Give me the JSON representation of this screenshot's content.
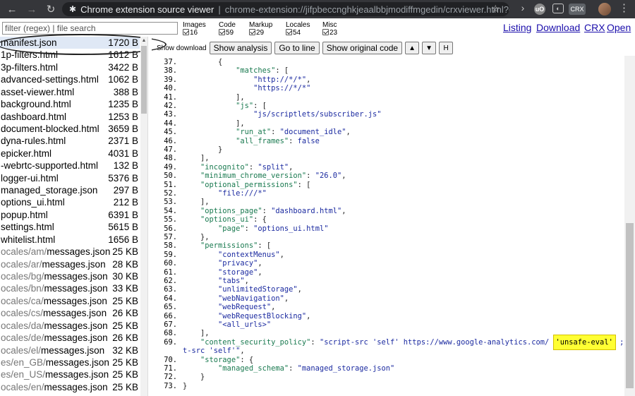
{
  "browser": {
    "tab_title": "Chrome extension source viewer",
    "url": "chrome-extension://jifpbeccnghkjeaalbbjmodiffmgedin/crxviewer.html?cr...",
    "ext_ublock": "uO",
    "ext_crx": "CRX"
  },
  "toolbar": {
    "filter_placeholder": "filter (regex) | file search",
    "categories": [
      {
        "label": "Images",
        "count": "16"
      },
      {
        "label": "Code",
        "count": "59"
      },
      {
        "label": "Markup",
        "count": "29"
      },
      {
        "label": "Locales",
        "count": "54"
      },
      {
        "label": "Misc",
        "count": "23"
      }
    ],
    "links": [
      "Listing",
      "Download",
      "CRX",
      "Open"
    ]
  },
  "code_toolbar": {
    "toggle_text": "Show download",
    "buttons": [
      "Show analysis",
      "Go to line",
      "Show original code",
      "▲",
      "▼",
      "H"
    ]
  },
  "files": [
    {
      "dir": "",
      "name": "manifest.json",
      "size": "1720 B",
      "selected": true
    },
    {
      "dir": "",
      "name": "1p-filters.html",
      "size": "1612 B"
    },
    {
      "dir": "",
      "name": "3p-filters.html",
      "size": "3422 B"
    },
    {
      "dir": "",
      "name": "advanced-settings.html",
      "size": "1062 B"
    },
    {
      "dir": "",
      "name": "asset-viewer.html",
      "size": "388 B"
    },
    {
      "dir": "",
      "name": "background.html",
      "size": "1235 B"
    },
    {
      "dir": "",
      "name": "dashboard.html",
      "size": "1253 B"
    },
    {
      "dir": "",
      "name": "document-blocked.html",
      "size": "3659 B"
    },
    {
      "dir": "",
      "name": "dyna-rules.html",
      "size": "2371 B"
    },
    {
      "dir": "",
      "name": "epicker.html",
      "size": "4031 B"
    },
    {
      "dir": "",
      "name": "-webrtc-supported.html",
      "size": "132 B"
    },
    {
      "dir": "",
      "name": "logger-ui.html",
      "size": "5376 B"
    },
    {
      "dir": "",
      "name": "managed_storage.json",
      "size": "297 B"
    },
    {
      "dir": "",
      "name": "options_ui.html",
      "size": "212 B"
    },
    {
      "dir": "",
      "name": "popup.html",
      "size": "6391 B"
    },
    {
      "dir": "",
      "name": "settings.html",
      "size": "5615 B"
    },
    {
      "dir": "",
      "name": "whitelist.html",
      "size": "1656 B"
    },
    {
      "dir": "ocales/am/",
      "name": "messages.json",
      "size": "25 KB"
    },
    {
      "dir": "ocales/ar/",
      "name": "messages.json",
      "size": "28 KB"
    },
    {
      "dir": "ocales/bg/",
      "name": "messages.json",
      "size": "30 KB"
    },
    {
      "dir": "ocales/bn/",
      "name": "messages.json",
      "size": "33 KB"
    },
    {
      "dir": "ocales/ca/",
      "name": "messages.json",
      "size": "25 KB"
    },
    {
      "dir": "ocales/cs/",
      "name": "messages.json",
      "size": "26 KB"
    },
    {
      "dir": "ocales/da/",
      "name": "messages.json",
      "size": "25 KB"
    },
    {
      "dir": "ocales/de/",
      "name": "messages.json",
      "size": "26 KB"
    },
    {
      "dir": "ocales/el/",
      "name": "messages.json",
      "size": "32 KB"
    },
    {
      "dir": "es/en_GB/",
      "name": "messages.json",
      "size": "25 KB"
    },
    {
      "dir": "es/en_US/",
      "name": "messages.json",
      "size": "25 KB"
    },
    {
      "dir": "ocales/en/",
      "name": "messages.json",
      "size": "25 KB"
    }
  ],
  "code_lines": [
    {
      "n": "37.",
      "parts": [
        [
          "p",
          "        {"
        ]
      ]
    },
    {
      "n": "38.",
      "parts": [
        [
          "k",
          "            \"matches\""
        ],
        [
          "p",
          ": ["
        ]
      ]
    },
    {
      "n": "39.",
      "parts": [
        [
          "s",
          "                \"http://*/*\""
        ],
        [
          "p",
          ","
        ]
      ]
    },
    {
      "n": "40.",
      "parts": [
        [
          "s",
          "                \"https://*/*\""
        ]
      ]
    },
    {
      "n": "41.",
      "parts": [
        [
          "p",
          "            ],"
        ]
      ]
    },
    {
      "n": "42.",
      "parts": [
        [
          "k",
          "            \"js\""
        ],
        [
          "p",
          ": ["
        ]
      ]
    },
    {
      "n": "43.",
      "parts": [
        [
          "s",
          "                \"js/scriptlets/subscriber.js\""
        ]
      ]
    },
    {
      "n": "44.",
      "parts": [
        [
          "p",
          "            ],"
        ]
      ]
    },
    {
      "n": "45.",
      "parts": [
        [
          "k",
          "            \"run_at\""
        ],
        [
          "p",
          ": "
        ],
        [
          "s",
          "\"document_idle\""
        ],
        [
          "p",
          ","
        ]
      ]
    },
    {
      "n": "46.",
      "parts": [
        [
          "k",
          "            \"all_frames\""
        ],
        [
          "p",
          ": "
        ],
        [
          "s",
          "false"
        ]
      ]
    },
    {
      "n": "47.",
      "parts": [
        [
          "p",
          "        }"
        ]
      ]
    },
    {
      "n": "48.",
      "parts": [
        [
          "p",
          "    ],"
        ]
      ]
    },
    {
      "n": "49.",
      "parts": [
        [
          "k",
          "    \"incognito\""
        ],
        [
          "p",
          ": "
        ],
        [
          "s",
          "\"split\""
        ],
        [
          "p",
          ","
        ]
      ]
    },
    {
      "n": "50.",
      "parts": [
        [
          "k",
          "    \"minimum_chrome_version\""
        ],
        [
          "p",
          ": "
        ],
        [
          "s",
          "\"26.0\""
        ],
        [
          "p",
          ","
        ]
      ]
    },
    {
      "n": "51.",
      "parts": [
        [
          "k",
          "    \"optional_permissions\""
        ],
        [
          "p",
          ": ["
        ]
      ]
    },
    {
      "n": "52.",
      "parts": [
        [
          "s",
          "        \"file:///*\""
        ]
      ]
    },
    {
      "n": "53.",
      "parts": [
        [
          "p",
          "    ],"
        ]
      ]
    },
    {
      "n": "54.",
      "parts": [
        [
          "k",
          "    \"options_page\""
        ],
        [
          "p",
          ": "
        ],
        [
          "s",
          "\"dashboard.html\""
        ],
        [
          "p",
          ","
        ]
      ]
    },
    {
      "n": "55.",
      "parts": [
        [
          "k",
          "    \"options_ui\""
        ],
        [
          "p",
          ": {"
        ]
      ]
    },
    {
      "n": "56.",
      "parts": [
        [
          "k",
          "        \"page\""
        ],
        [
          "p",
          ": "
        ],
        [
          "s",
          "\"options_ui.html\""
        ]
      ]
    },
    {
      "n": "57.",
      "parts": [
        [
          "p",
          "    },"
        ]
      ]
    },
    {
      "n": "58.",
      "parts": [
        [
          "k",
          "    \"permissions\""
        ],
        [
          "p",
          ": ["
        ]
      ]
    },
    {
      "n": "59.",
      "parts": [
        [
          "s",
          "        \"contextMenus\""
        ],
        [
          "p",
          ","
        ]
      ]
    },
    {
      "n": "60.",
      "parts": [
        [
          "s",
          "        \"privacy\""
        ],
        [
          "p",
          ","
        ]
      ]
    },
    {
      "n": "61.",
      "parts": [
        [
          "s",
          "        \"storage\""
        ],
        [
          "p",
          ","
        ]
      ]
    },
    {
      "n": "62.",
      "parts": [
        [
          "s",
          "        \"tabs\""
        ],
        [
          "p",
          ","
        ]
      ]
    },
    {
      "n": "63.",
      "parts": [
        [
          "s",
          "        \"unlimitedStorage\""
        ],
        [
          "p",
          ","
        ]
      ]
    },
    {
      "n": "64.",
      "parts": [
        [
          "s",
          "        \"webNavigation\""
        ],
        [
          "p",
          ","
        ]
      ]
    },
    {
      "n": "65.",
      "parts": [
        [
          "s",
          "        \"webRequest\""
        ],
        [
          "p",
          ","
        ]
      ]
    },
    {
      "n": "66.",
      "parts": [
        [
          "s",
          "        \"webRequestBlocking\""
        ],
        [
          "p",
          ","
        ]
      ]
    },
    {
      "n": "67.",
      "parts": [
        [
          "s",
          "        \"<all_urls>\""
        ]
      ]
    },
    {
      "n": "68.",
      "parts": [
        [
          "p",
          "    ],"
        ]
      ]
    },
    {
      "n": "69.",
      "parts": [
        [
          "k",
          "    \"content_security_policy\""
        ],
        [
          "p",
          ": "
        ],
        [
          "s",
          "\"script-src 'self' https://www.google-analytics.com/ "
        ],
        [
          "hl",
          "'unsafe-eval'"
        ],
        [
          "s",
          " ; objec"
        ]
      ]
    },
    {
      "n": "",
      "parts": [
        [
          "s",
          "t-src 'self'\""
        ],
        [
          "p",
          ","
        ]
      ],
      "wrap": true
    },
    {
      "n": "70.",
      "parts": [
        [
          "k",
          "    \"storage\""
        ],
        [
          "p",
          ": {"
        ]
      ]
    },
    {
      "n": "71.",
      "parts": [
        [
          "k",
          "        \"managed_schema\""
        ],
        [
          "p",
          ": "
        ],
        [
          "s",
          "\"managed_storage.json\""
        ]
      ]
    },
    {
      "n": "72.",
      "parts": [
        [
          "p",
          "    }"
        ]
      ]
    },
    {
      "n": "73.",
      "parts": [
        [
          "p",
          "}"
        ]
      ]
    }
  ]
}
